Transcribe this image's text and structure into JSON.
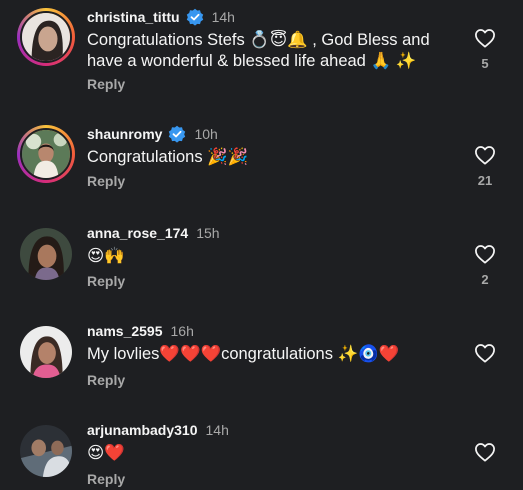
{
  "comments": [
    {
      "username": "christina_tittu",
      "verified": true,
      "time": "14h",
      "text_line1": "Congratulations Stefs 💍😇🔔 , God Bless and",
      "text_line2": "have a wonderful & blessed life ahead 🙏 ✨",
      "reply_label": "Reply",
      "likes": "5"
    },
    {
      "username": "shaunromy",
      "verified": true,
      "time": "10h",
      "text_line1": "Congratulations 🎉🎉",
      "reply_label": "Reply",
      "likes": "21"
    },
    {
      "username": "anna_rose_174",
      "verified": false,
      "time": "15h",
      "text_line1": "😍🙌",
      "reply_label": "Reply",
      "likes": "2"
    },
    {
      "username": "nams_2595",
      "verified": false,
      "time": "16h",
      "text_line1": "My lovlies❤️❤️❤️congratulations ✨🧿❤️",
      "reply_label": "Reply",
      "likes": ""
    },
    {
      "username": "arjunambady310",
      "verified": false,
      "time": "14h",
      "text_line1": "😍❤️",
      "reply_label": "Reply",
      "likes": ""
    }
  ],
  "colors": {
    "background": "#1e1f22",
    "text": "#f5f5f5",
    "muted": "#a8a8a8",
    "verified": "#3897f0"
  }
}
